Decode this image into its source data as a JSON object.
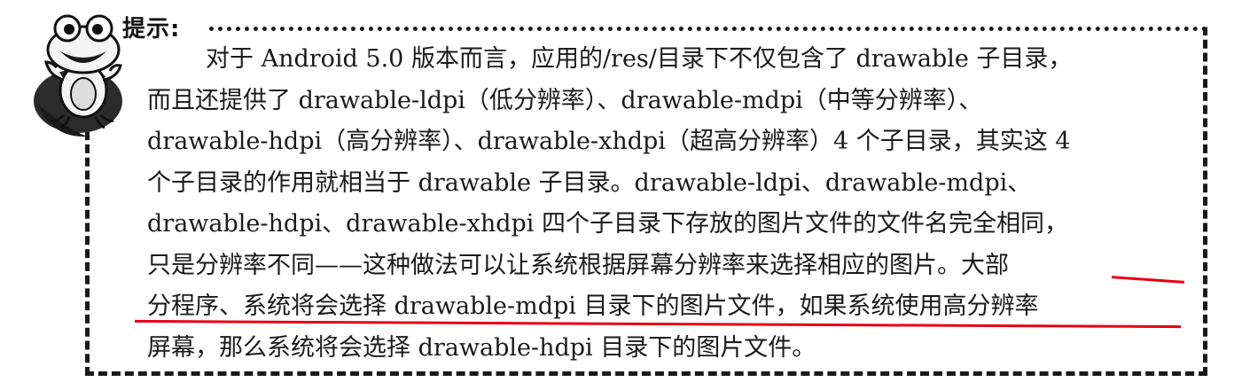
{
  "tip": {
    "label": "提示:"
  },
  "paragraph": {
    "lines": [
      "对于 Android 5.0 版本而言，应用的/res/目录下不仅包含了 drawable 子目录，",
      "而且还提供了 drawable-ldpi（低分辨率）、drawable-mdpi（中等分辨率）、",
      "drawable-hdpi（高分辨率）、drawable-xhdpi（超高分辨率）4 个子目录，其实这 4",
      "个子目录的作用就相当于 drawable 子目录。drawable-ldpi、drawable-mdpi、",
      "drawable-hdpi、drawable-xhdpi 四个子目录下存放的图片文件的文件名完全相同，",
      "只是分辨率不同——这种做法可以让系统根据屏幕分辨率来选择相应的图片。大部",
      "分程序、系统将会选择 drawable-mdpi 目录下的图片文件，如果系统使用高分辨率",
      "屏幕，那么系统将会选择 drawable-hdpi 目录下的图片文件。"
    ]
  },
  "colors": {
    "highlight": "#e60012",
    "text": "#1a1a1a"
  },
  "icons": {
    "mascot": "frog-mascot-icon"
  }
}
